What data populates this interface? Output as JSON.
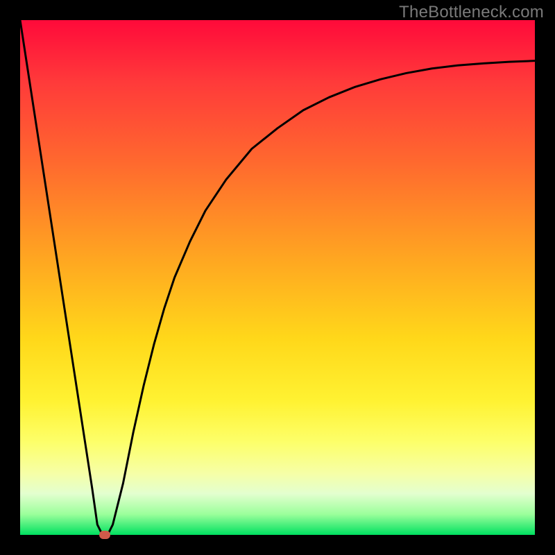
{
  "watermark": "TheBottleneck.com",
  "chart_data": {
    "type": "line",
    "title": "",
    "xlabel": "",
    "ylabel": "",
    "xlim": [
      0,
      100
    ],
    "ylim": [
      0,
      100
    ],
    "grid": false,
    "legend": false,
    "series": [
      {
        "name": "curve",
        "color": "#000000",
        "x": [
          0,
          2,
          4,
          6,
          8,
          10,
          12,
          14,
          15,
          16,
          17,
          18,
          20,
          22,
          24,
          26,
          28,
          30,
          33,
          36,
          40,
          45,
          50,
          55,
          60,
          65,
          70,
          75,
          80,
          85,
          90,
          95,
          100
        ],
        "y": [
          100,
          87,
          74,
          61,
          48,
          35,
          22,
          9,
          2,
          0,
          0,
          2,
          10,
          20,
          29,
          37,
          44,
          50,
          57,
          63,
          69,
          75,
          79,
          82.5,
          85,
          87,
          88.5,
          89.7,
          90.6,
          91.2,
          91.6,
          91.9,
          92.1
        ]
      }
    ],
    "marker": {
      "x": 16.5,
      "y": 0
    },
    "background_gradient": {
      "top": "#ff0a3a",
      "mid": "#ffd81a",
      "bottom": "#00e060"
    }
  }
}
